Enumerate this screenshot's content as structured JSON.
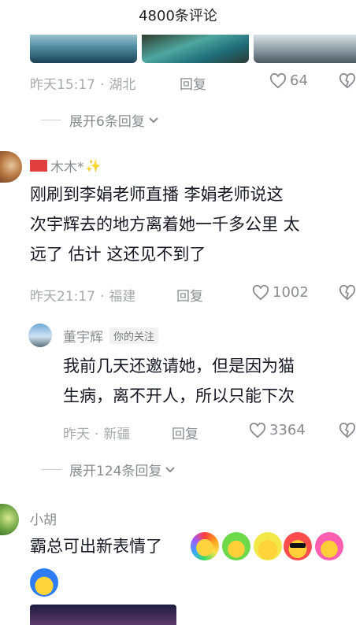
{
  "header": {
    "title": "4800条评论"
  },
  "comment_prev": {
    "time": "昨天15:17",
    "location": "湖北",
    "reply_label": "回复",
    "likes": "64"
  },
  "expand1": {
    "label": "展开6条回复"
  },
  "comment1": {
    "username": "木木*",
    "text_lines": [
      "刚刷到李娟老师直播  李娟老师说这",
      "次宇辉去的地方离着她一千多公里 太",
      "远了 估计 这还见不到了"
    ],
    "time": "昨天21:17",
    "location": "福建",
    "reply_label": "回复",
    "likes": "1002"
  },
  "reply1": {
    "username": "董宇辉",
    "badge": "你的关注",
    "text_lines": [
      "我前几天还邀请她，但是因为猫",
      "生病，离不开人，所以只能下次"
    ],
    "time": "昨天",
    "location": "新疆",
    "reply_label": "回复",
    "likes": "3364"
  },
  "expand2": {
    "label": "展开124条回复"
  },
  "comment2": {
    "username": "小胡",
    "text": "霸总可出新表情了"
  },
  "icons": {
    "like": "heart-outline-icon",
    "dislike": "heart-broken-icon",
    "expand": "chevron-down-icon"
  },
  "colors": {
    "meta": "#a8a9ad",
    "text": "#161823",
    "action": "#8a8b91"
  }
}
